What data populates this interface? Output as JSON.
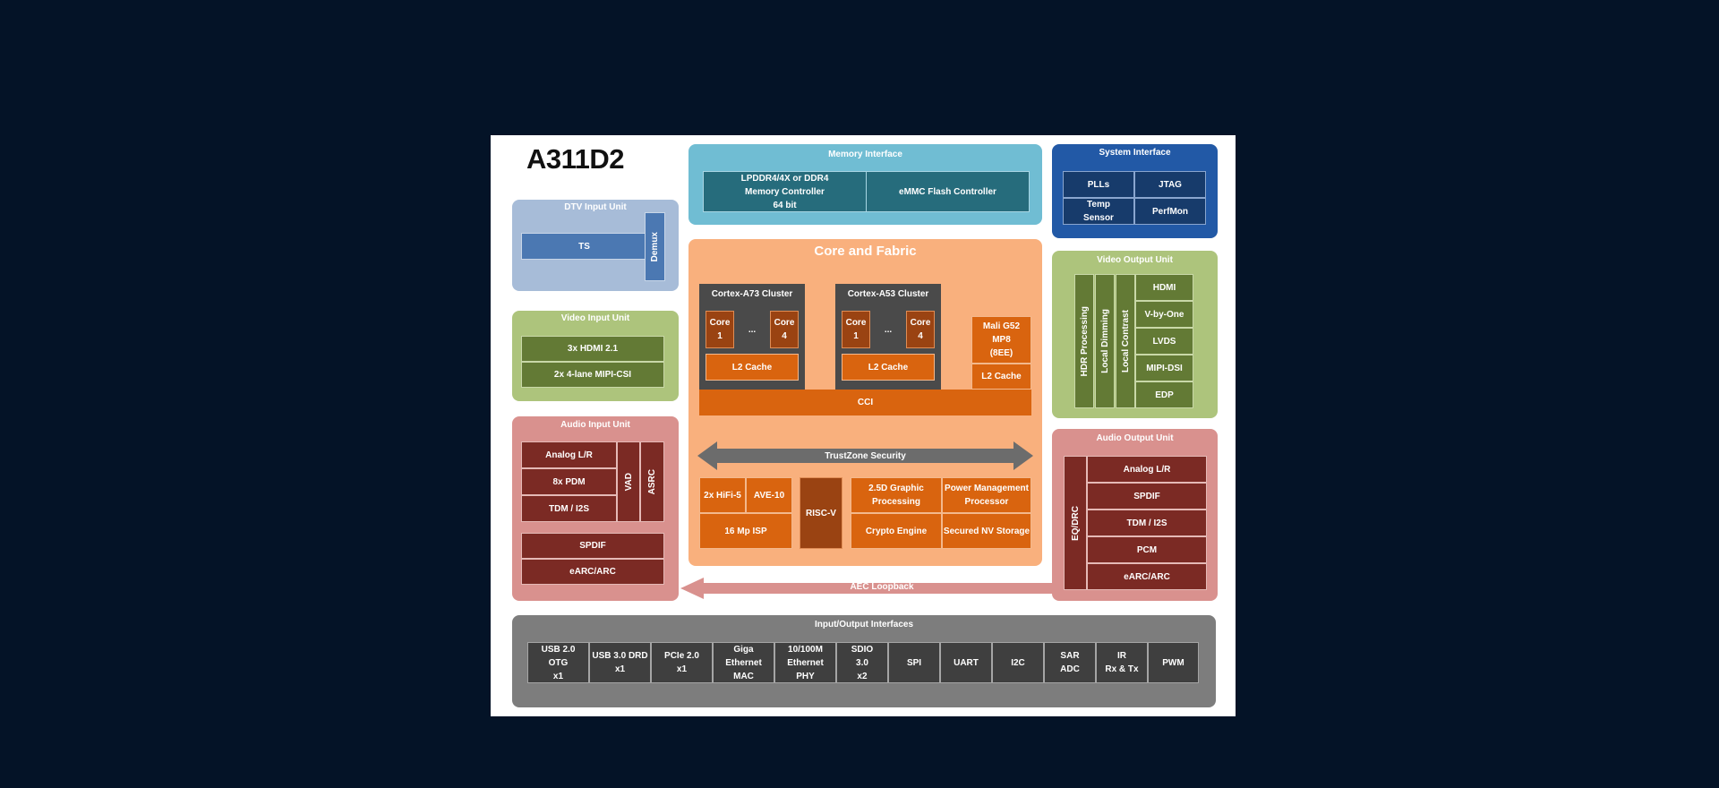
{
  "title": "A311D2",
  "dtv_input": {
    "title": "DTV Input Unit",
    "ts": "TS",
    "demux": "Demux"
  },
  "video_input": {
    "title": "Video Input Unit",
    "items": [
      "3x HDMI 2.1",
      "2x 4-lane MIPI-CSI"
    ]
  },
  "audio_input": {
    "title": "Audio Input Unit",
    "items": [
      "Analog L/R",
      "8x PDM",
      "TDM / I2S"
    ],
    "vad": "VAD",
    "asrc": "ASRC",
    "bottom_items": [
      "SPDIF",
      "eARC/ARC"
    ]
  },
  "memory": {
    "title": "Memory Interface",
    "controller": "LPDDR4/4X or  DDR4\nMemory Controller\n64 bit",
    "emmc": "eMMC Flash Controller"
  },
  "system": {
    "title": "System Interface",
    "items": [
      "PLLs",
      "JTAG",
      "Temp\nSensor",
      "PerfMon"
    ]
  },
  "core": {
    "title": "Core and Fabric",
    "a73": {
      "title": "Cortex-A73 Cluster",
      "core_first": "Core\n1",
      "ellipsis": "...",
      "core_last": "Core\n4",
      "l2": "L2 Cache"
    },
    "a53": {
      "title": "Cortex-A53 Cluster",
      "core_first": "Core\n1",
      "ellipsis": "...",
      "core_last": "Core\n4",
      "l2": "L2 Cache"
    },
    "gpu": {
      "name": "Mali G52\nMP8\n(8EE)",
      "l2": "L2 Cache"
    },
    "cci": "CCI",
    "trustzone": "TrustZone Security",
    "hifi": "2x  HiFi-5",
    "ave": "AVE-10",
    "isp": "16 Mp ISP",
    "riscv": "RISC-V",
    "graphic": "2.5D Graphic\nProcessing",
    "pmp": "Power Management\nProcessor",
    "crypto": "Crypto Engine",
    "nv": "Secured NV Storage"
  },
  "video_output": {
    "title": "Video Output Unit",
    "vertical": [
      "HDR Processing",
      "Local Dimming",
      "Local Contrast"
    ],
    "items": [
      "HDMI",
      "V-by-One",
      "LVDS",
      "MIPI-DSI",
      "EDP"
    ]
  },
  "audio_output": {
    "title": "Audio Output Unit",
    "eq": "EQ/DRC",
    "items": [
      "Analog L/R",
      "SPDIF",
      "TDM / I2S",
      "PCM",
      "eARC/ARC"
    ]
  },
  "aec": "AEC Loopback",
  "io": {
    "title": "Input/Output Interfaces",
    "items": [
      "USB 2.0\nOTG\nx1",
      "USB 3.0 DRD\nx1",
      "PCIe 2.0\nx1",
      "Giga\nEthernet\nMAC",
      "10/100M\nEthernet\nPHY",
      "SDIO\n3.0\nx2",
      "SPI",
      "UART",
      "I2C",
      "SAR\nADC",
      "IR\nRx & Tx",
      "PWM"
    ]
  }
}
